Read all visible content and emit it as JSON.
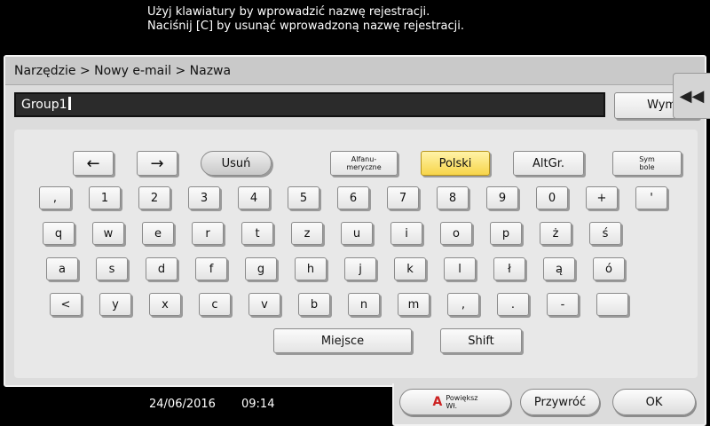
{
  "message": {
    "line1": "Użyj klawiatury by wprowadzić nazwę rejestracji.",
    "line2": "Naciśnij [C] by usunąć wprowadzoną nazwę rejestracji."
  },
  "breadcrumb": "Narzędzie > Nowy e-mail > Nazwa",
  "name_input": {
    "value": "Group1"
  },
  "clear_button": "Wymaż",
  "side_tab_icon": "rewind-icon",
  "keyboard": {
    "top": {
      "left_arrow": "←",
      "right_arrow": "→",
      "delete": "Usuń",
      "alphanumeric": "Alfanu-\nmeryczne",
      "polish": "Polski",
      "altgr": "AltGr.",
      "symbols": "Sym\nbole"
    },
    "row1": [
      ",",
      "1",
      "2",
      "3",
      "4",
      "5",
      "6",
      "7",
      "8",
      "9",
      "0",
      "+",
      "'"
    ],
    "row2": [
      "q",
      "w",
      "e",
      "r",
      "t",
      "z",
      "u",
      "i",
      "o",
      "p",
      "ż",
      "ś"
    ],
    "row3": [
      "a",
      "s",
      "d",
      "f",
      "g",
      "h",
      "j",
      "k",
      "l",
      "ł",
      "ą",
      "ó"
    ],
    "row4": [
      "<",
      "y",
      "x",
      "c",
      "v",
      "b",
      "n",
      "m",
      ",",
      ".",
      "-",
      ""
    ],
    "space": "Miejsce",
    "shift": "Shift"
  },
  "footer": {
    "date": "24/06/2016",
    "time": "09:14"
  },
  "bottom": {
    "magnify": "Powiększ\nWł.",
    "restore": "Przywróć",
    "ok": "OK"
  },
  "colors": {
    "active_key": "#f7d54a",
    "background": "#000000"
  }
}
